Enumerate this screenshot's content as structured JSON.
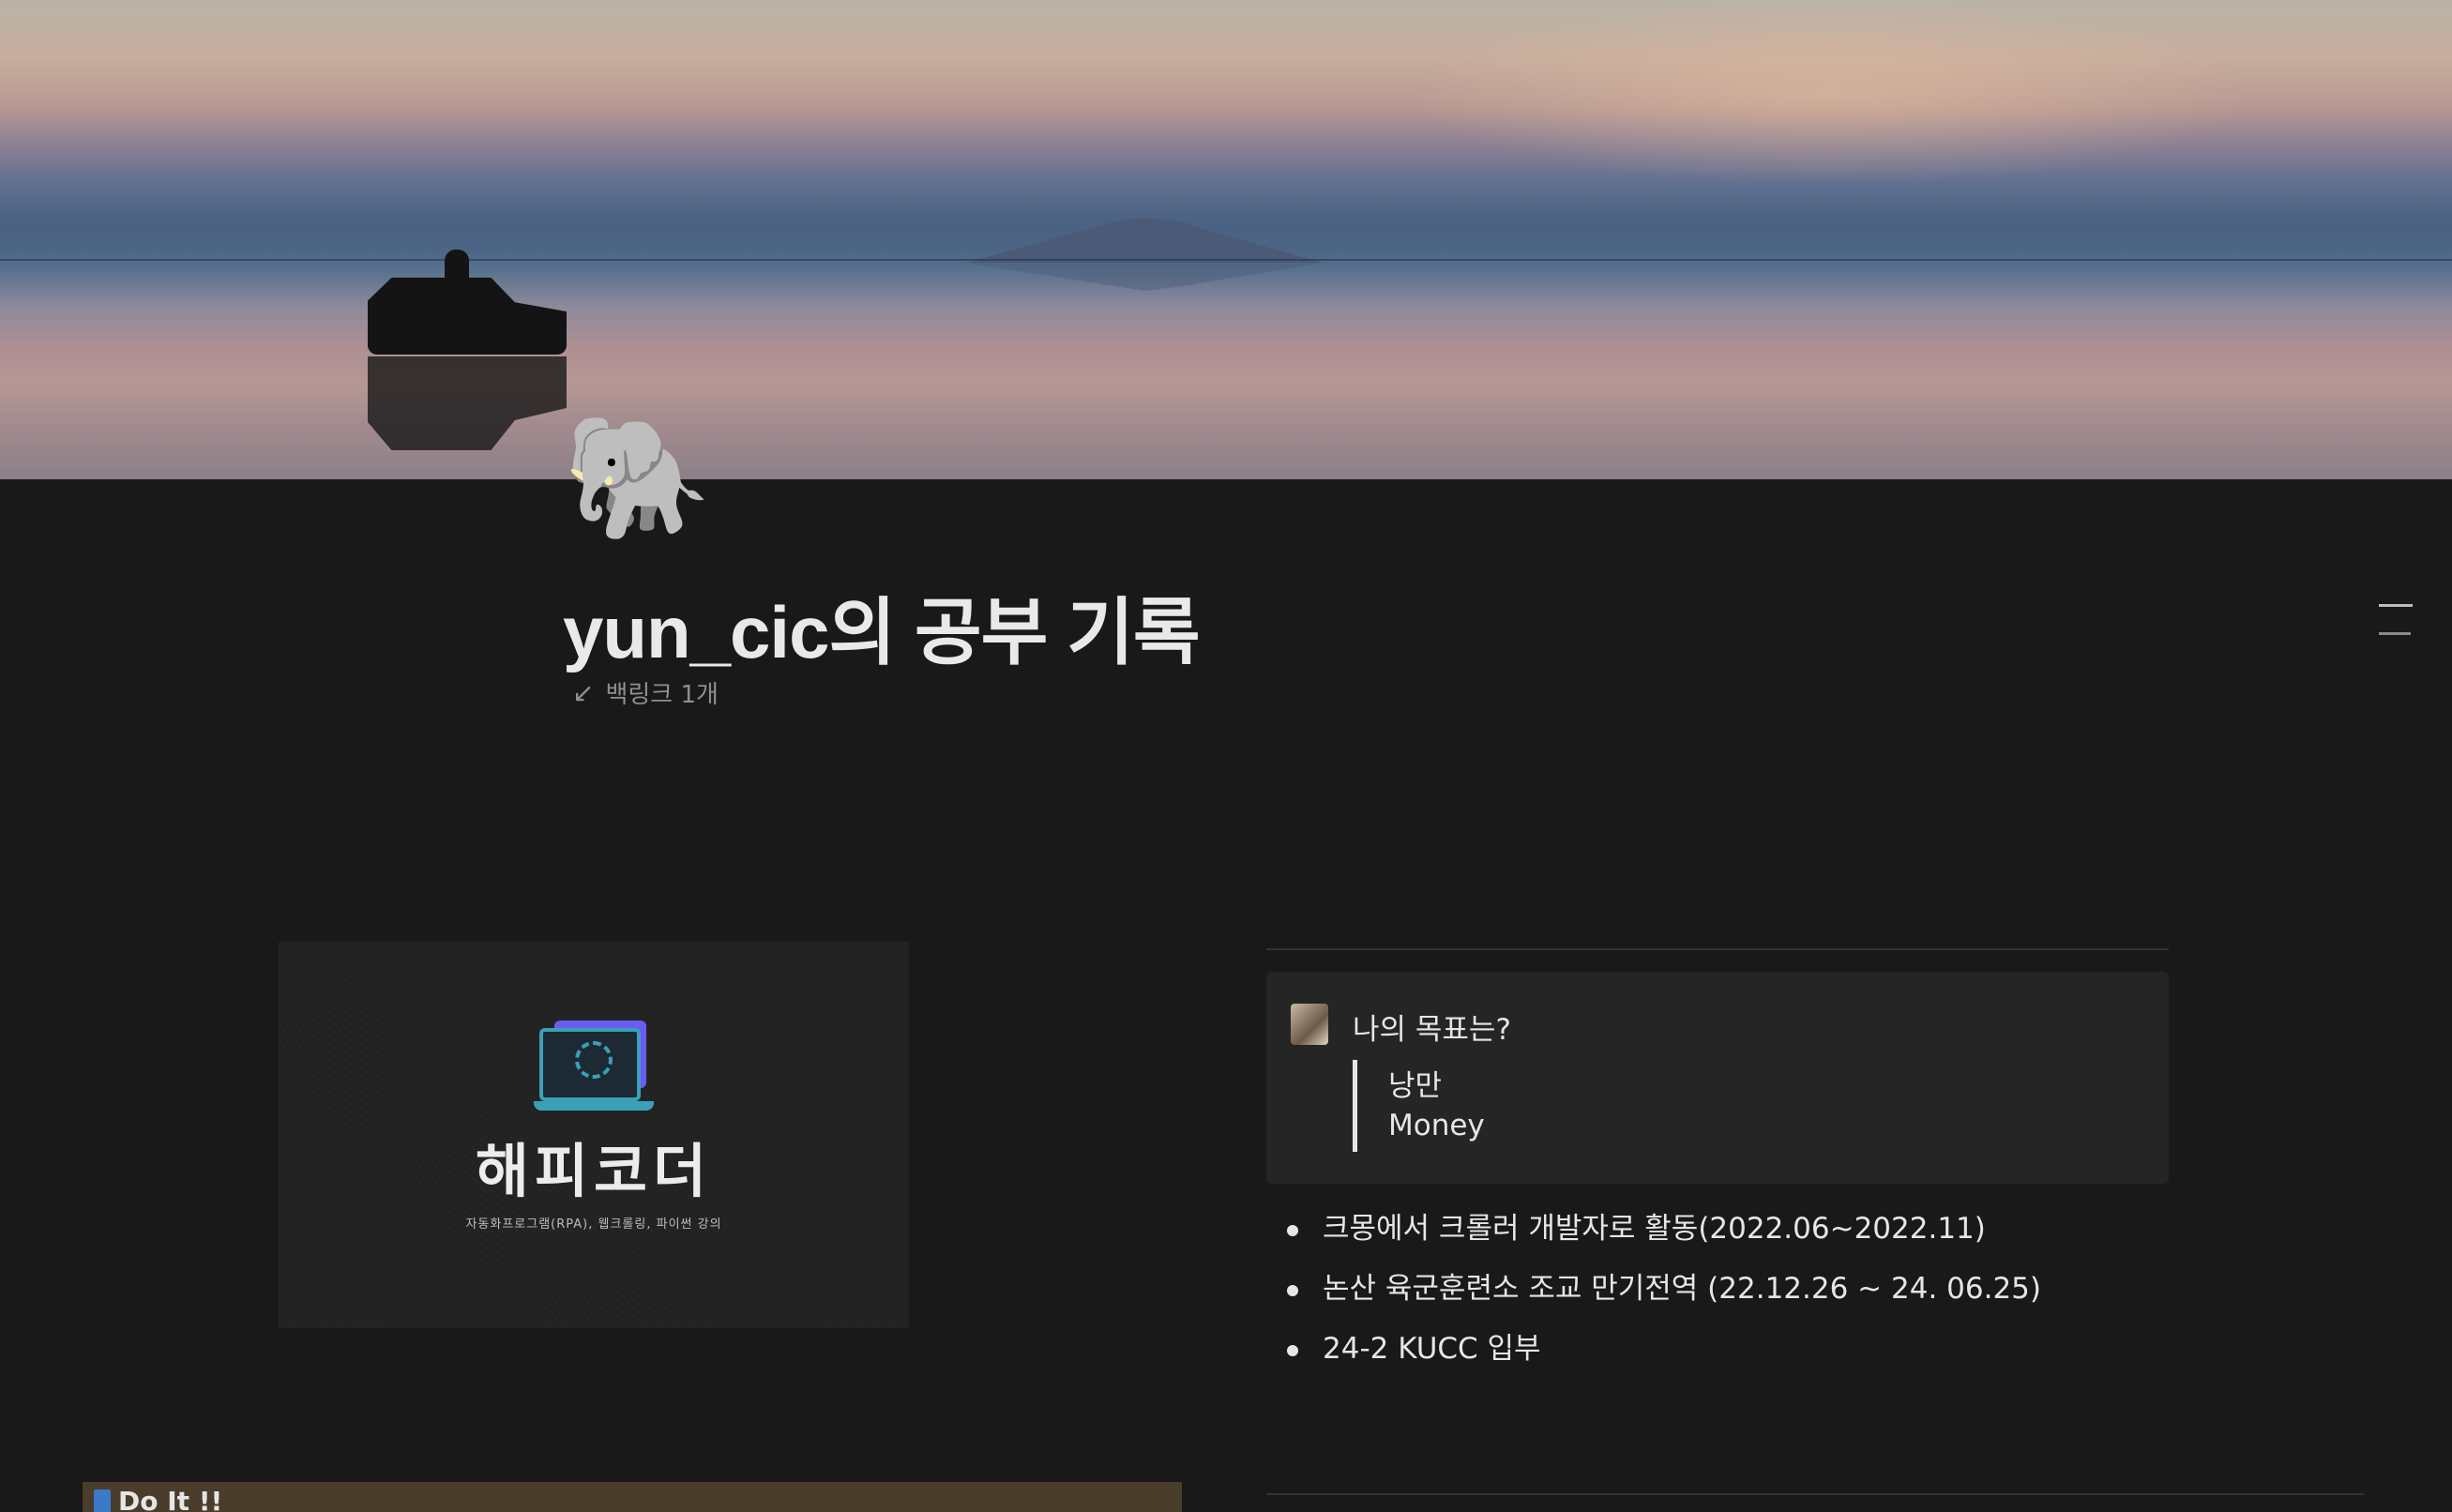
{
  "page": {
    "title": "yun_cic의 공부 기록",
    "icon": "🐘",
    "backlinks": "백링크 1개"
  },
  "promo": {
    "brand": "해피코더",
    "tagline": "자동화프로그램(RPA), 웹크롤링, 파이썬 강의"
  },
  "callout": {
    "question": "나의 목표는?",
    "quote_lines": [
      "낭만",
      "Money"
    ]
  },
  "bullets": [
    "크몽에서 크롤러 개발자로 활동(2022.06~2022.11)",
    "논산 육군훈련소 조교 만기전역 (22.12.26 ~ 24. 06.25)",
    "24-2 KUCC 입부"
  ],
  "bottom": {
    "label": "Do It !!"
  },
  "icons": {
    "backlink": "backlink-arrow-icon",
    "toc": "table-of-contents-icon",
    "laptop": "laptop-gear-icon",
    "book": "book-icon"
  },
  "colors": {
    "background": "#191919",
    "callout_bg": "#252525",
    "bottom_block": "#4a3d2b"
  }
}
